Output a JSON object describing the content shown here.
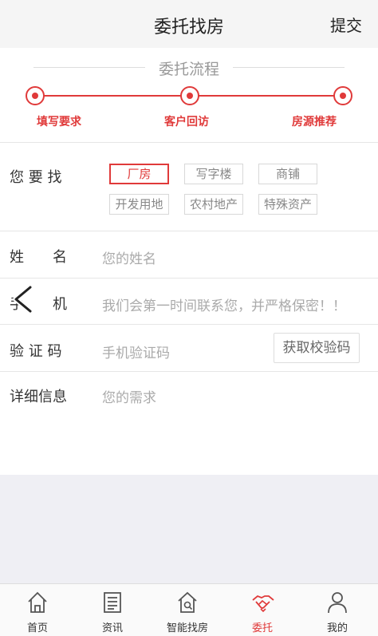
{
  "header": {
    "title": "委托找房",
    "submit_label": "提交"
  },
  "flow": {
    "title": "委托流程",
    "steps": [
      "填写要求",
      "客户回访",
      "房源推荐"
    ]
  },
  "demand": {
    "label": "您 要 找",
    "options": [
      "厂房",
      "写字楼",
      "商铺",
      "开发用地",
      "农村地产",
      "特殊资产"
    ],
    "selected": "厂房"
  },
  "form": {
    "name_label": "姓　　名",
    "name_placeholder": "您的姓名",
    "phone_label": "手　　机",
    "phone_placeholder": "我们会第一时间联系您，并严格保密！！",
    "code_label": "验 证 码",
    "code_placeholder": "手机验证码",
    "code_button": "获取校验码",
    "detail_label": "详细信息",
    "detail_placeholder": "您的需求"
  },
  "tabbar": {
    "items": [
      {
        "label": "首页",
        "icon": "home-icon"
      },
      {
        "label": "资讯",
        "icon": "news-icon"
      },
      {
        "label": "智能找房",
        "icon": "smart-house-icon"
      },
      {
        "label": "委托",
        "icon": "handshake-icon"
      },
      {
        "label": "我的",
        "icon": "person-icon"
      }
    ],
    "active": "委托"
  },
  "colors": {
    "accent": "#e03a3a",
    "text": "#333333",
    "placeholder": "#aaaaaa",
    "background": "#efeff4"
  }
}
